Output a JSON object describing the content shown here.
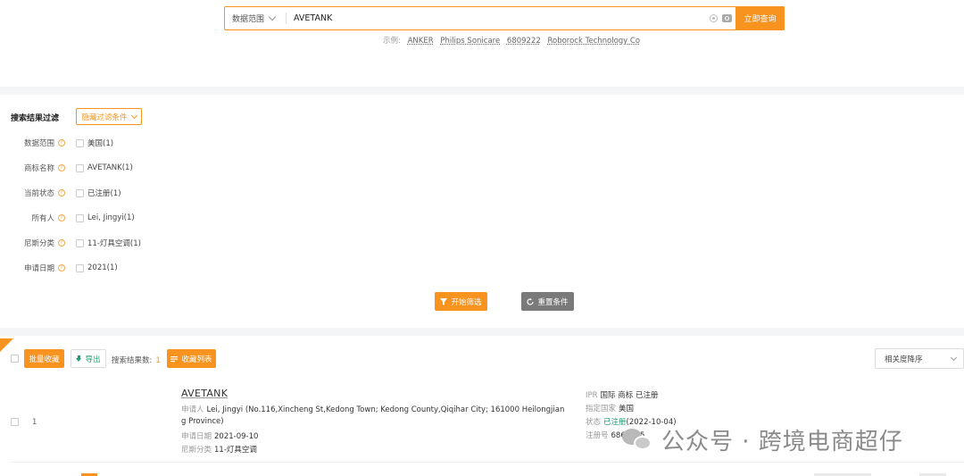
{
  "search": {
    "scope_label": "数据范围",
    "query": "AVETANK",
    "submit_label": "立即查询",
    "examples_label": "示例:",
    "examples": [
      "ANKER",
      "Philips Sonicare",
      "6809222",
      "Roborock Technology Co"
    ]
  },
  "filter": {
    "title": "搜索结果过滤",
    "hide_label": "隐藏过滤条件",
    "rows": [
      {
        "label": "数据范围",
        "option": "美国(1)"
      },
      {
        "label": "商标名称",
        "option": "AVETANK(1)"
      },
      {
        "label": "当前状态",
        "option": "已注册(1)"
      },
      {
        "label": "所有人",
        "option": "Lei, Jingyi(1)"
      },
      {
        "label": "尼斯分类",
        "option": "11-灯具空调(1)"
      },
      {
        "label": "申请日期",
        "option": "2021(1)"
      }
    ],
    "apply_label": "开始筛选",
    "reset_label": "重置条件"
  },
  "toolbar": {
    "batch_label": "批量收藏",
    "export_label": "导出",
    "count_label": "搜索结果数:",
    "count_value": "1",
    "favorites_label": "收藏列表",
    "sort_label": "相关度降序"
  },
  "result": {
    "index": "1",
    "name": "AVETANK",
    "applicant_label": "申请人",
    "applicant_line1": "Lei, Jingyi (No.116,Xincheng St,Kedong Town; Kedong County,Qiqihar City; 161000 Heilongjian",
    "applicant_line2": "g Province)",
    "date_label": "申请日期",
    "date_value": "2021-09-10",
    "class_label": "尼斯分类",
    "class_value": "11-灯具空调",
    "ipr_label": "IPR",
    "ipr_value": "国际 商标 已注册",
    "country_label": "指定国家",
    "country_value": "美国",
    "status_label": "状态",
    "status_value": "已注册",
    "status_date": "(2022-10-04)",
    "reg_label": "注册号",
    "reg_value": "6865335"
  },
  "watermark": {
    "text": "公众号 · 跨境电商超仔"
  },
  "colors": {
    "accent": "#f7931e",
    "green": "#1aa06d",
    "gray_button": "#7a7a7a"
  }
}
